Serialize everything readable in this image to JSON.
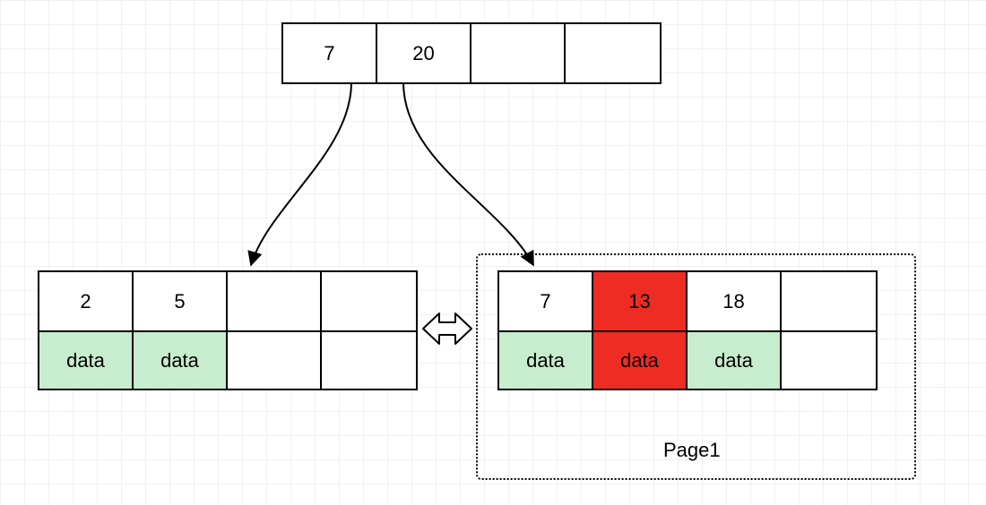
{
  "colors": {
    "green": "#c8ecce",
    "red": "#ef2c23"
  },
  "root": {
    "keys": [
      "7",
      "20",
      "",
      ""
    ]
  },
  "leaf_left": {
    "keys": [
      "2",
      "5",
      "",
      ""
    ],
    "data": [
      "data",
      "data",
      "",
      ""
    ],
    "key_highlight": [
      "none",
      "none",
      "none",
      "none"
    ],
    "data_highlight": [
      "green",
      "green",
      "none",
      "none"
    ]
  },
  "leaf_right": {
    "keys": [
      "7",
      "13",
      "18",
      ""
    ],
    "data": [
      "data",
      "data",
      "data",
      ""
    ],
    "key_highlight": [
      "none",
      "red",
      "none",
      "none"
    ],
    "data_highlight": [
      "green",
      "red",
      "green",
      "none"
    ]
  },
  "page_label": "Page1"
}
